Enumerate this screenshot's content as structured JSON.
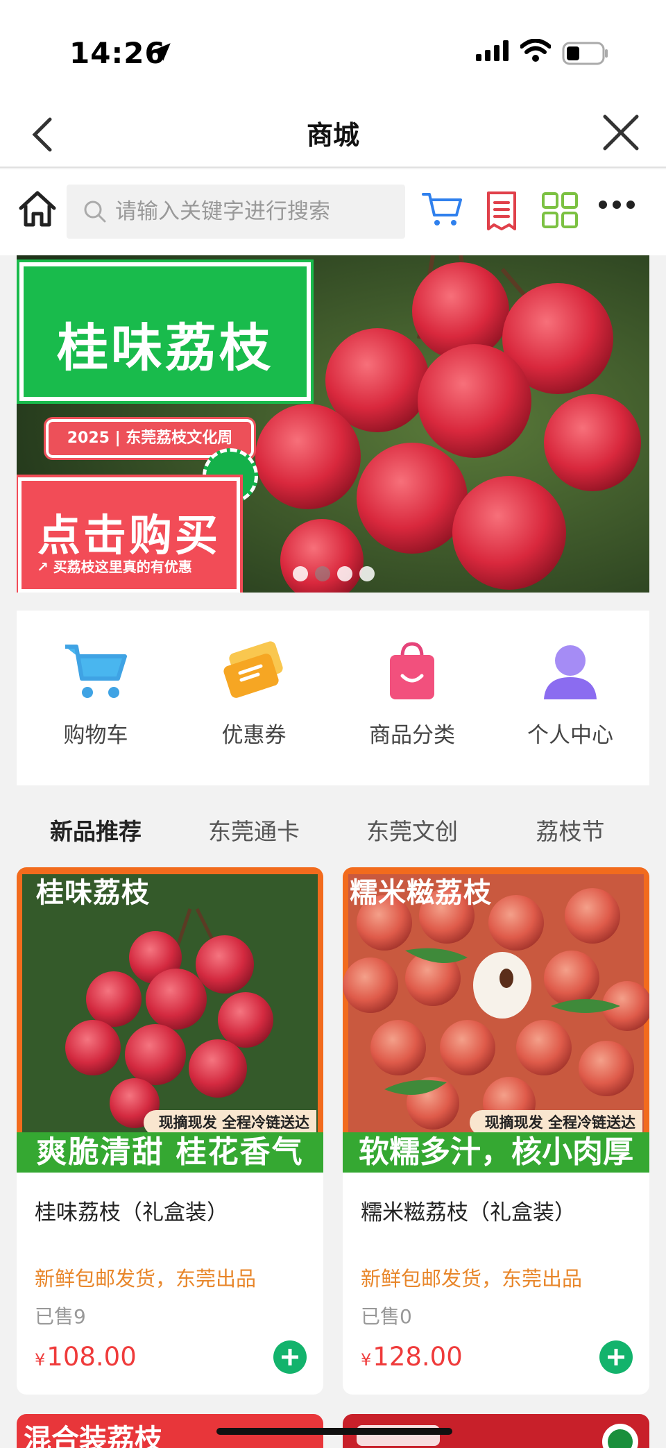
{
  "status_bar": {
    "time": "14:26"
  },
  "nav": {
    "title": "商城"
  },
  "search": {
    "placeholder": "请输入关键字进行搜索"
  },
  "banner": {
    "title": "桂味荔枝",
    "tag": "2025 | 东莞荔枝文化周",
    "buy_title": "点击购买",
    "buy_sub": "↗ 买荔枝这里真的有优惠",
    "active_slide": 1,
    "slide_count": 4
  },
  "quick_menu": [
    {
      "label": "购物车",
      "icon": "cart-icon",
      "color": "#3fb1ef"
    },
    {
      "label": "优惠券",
      "icon": "coupon-icon",
      "color": "#f6a623"
    },
    {
      "label": "商品分类",
      "icon": "shopping-bag-icon",
      "color": "#f2507d"
    },
    {
      "label": "个人中心",
      "icon": "user-icon",
      "color": "#8b6cf0"
    }
  ],
  "tabs": [
    {
      "label": "新品推荐",
      "active": true
    },
    {
      "label": "东莞通卡",
      "active": false
    },
    {
      "label": "东莞文创",
      "active": false
    },
    {
      "label": "荔枝节",
      "active": false
    }
  ],
  "products": [
    {
      "image_tag": "桂味荔枝",
      "image_strip": "现摘现发 全程冷链送达",
      "image_slogan": "爽脆清甜 桂花香气",
      "name": "桂味荔枝（礼盒装）",
      "subtitle": "新鲜包邮发货，东莞出品",
      "sold": "已售9",
      "currency": "¥",
      "price": "108.00"
    },
    {
      "image_tag": "糯米糍荔枝",
      "image_strip": "现摘现发 全程冷链送达",
      "image_slogan": "软糯多汁，核小肉厚",
      "name": "糯米糍荔枝（礼盒装）",
      "subtitle": "新鲜包邮发货，东莞出品",
      "sold": "已售0",
      "currency": "¥",
      "price": "128.00"
    }
  ],
  "next_products": [
    {
      "image_tag": "混合装荔枝"
    }
  ],
  "colors": {
    "accent_green": "#19bb4c",
    "price_red": "#ef3b3b",
    "subtitle_orange": "#e8862a",
    "add_button_green": "#13b36c",
    "banner_red": "#f24c57"
  }
}
